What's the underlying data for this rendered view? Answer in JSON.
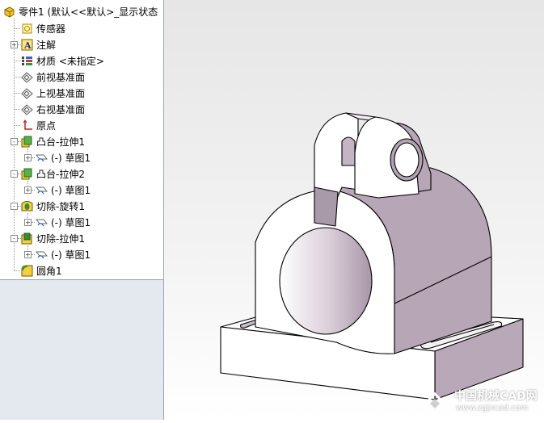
{
  "tree": {
    "root": "零件1  (默认<<默认>_显示状态",
    "items": [
      {
        "label": "传感器",
        "icon": "sensor-icon"
      },
      {
        "label": "注解",
        "icon": "annotation-icon"
      },
      {
        "label": "材质 <未指定>",
        "icon": "material-icon"
      },
      {
        "label": "前视基准面",
        "icon": "plane-icon"
      },
      {
        "label": "上视基准面",
        "icon": "plane-icon"
      },
      {
        "label": "右视基准面",
        "icon": "plane-icon"
      },
      {
        "label": "原点",
        "icon": "origin-icon"
      },
      {
        "label": "凸台-拉伸1",
        "icon": "boss-extrude-icon"
      },
      {
        "label": "(-) 草图1",
        "icon": "sketch-icon"
      },
      {
        "label": "凸台-拉伸2",
        "icon": "boss-extrude-icon"
      },
      {
        "label": "(-) 草图1",
        "icon": "sketch-icon"
      },
      {
        "label": "切除-旋转1",
        "icon": "cut-revolve-icon"
      },
      {
        "label": "(-) 草图1",
        "icon": "sketch-icon"
      },
      {
        "label": "切除-拉伸1",
        "icon": "cut-extrude-icon"
      },
      {
        "label": "(-) 草图1",
        "icon": "sketch-icon"
      },
      {
        "label": "圆角1",
        "icon": "fillet-icon"
      }
    ]
  },
  "watermark": {
    "line1": "中国机械CAD网",
    "line2": "www.zgjxcad.com"
  },
  "colors": {
    "face_light": "#ffffff",
    "face_shade": "#b8a7b7",
    "edge": "#000000",
    "tree_bg": "#ffffff",
    "lower_panel": "#e4e9f0"
  }
}
